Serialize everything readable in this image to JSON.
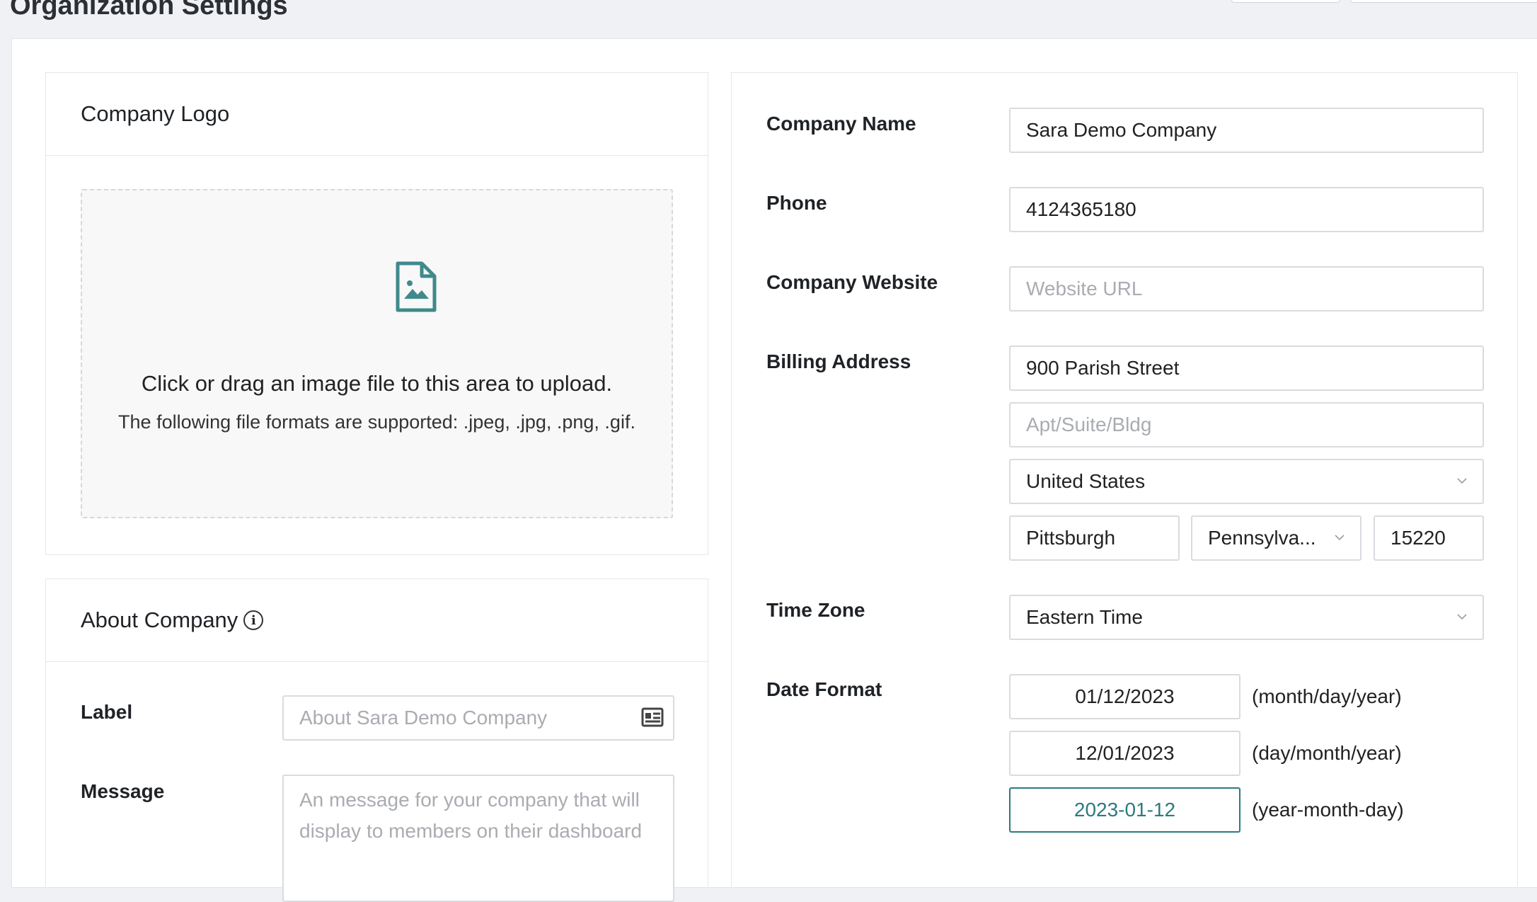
{
  "page": {
    "title": "Organization Settings"
  },
  "logo_card": {
    "title": "Company Logo",
    "drop_title": "Click or drag an image file to this area to upload.",
    "drop_subtitle": "The following file formats are supported: .jpeg, .jpg, .png, .gif.",
    "icon": "image-file-icon"
  },
  "about_card": {
    "title": "About Company",
    "label_field": {
      "label": "Label",
      "placeholder": "About Sara Demo Company",
      "icon": "id-card-icon"
    },
    "message_field": {
      "label": "Message",
      "placeholder": "An message for your company that will display to members on their dashboard"
    }
  },
  "company": {
    "name": {
      "label": "Company Name",
      "value": "Sara Demo Company"
    },
    "phone": {
      "label": "Phone",
      "value": "4124365180"
    },
    "website": {
      "label": "Company Website",
      "placeholder": "Website URL"
    },
    "billing": {
      "label": "Billing Address",
      "street": "900 Parish Street",
      "apt_placeholder": "Apt/Suite/Bldg",
      "country": "United States",
      "city": "Pittsburgh",
      "state": "Pennsylva...",
      "zip": "15220"
    },
    "timezone": {
      "label": "Time Zone",
      "value": "Eastern Time"
    },
    "date_format": {
      "label": "Date Format",
      "options": [
        {
          "example": "01/12/2023",
          "note": "(month/day/year)",
          "selected": false
        },
        {
          "example": "12/01/2023",
          "note": "(day/month/year)",
          "selected": false
        },
        {
          "example": "2023-01-12",
          "note": "(year-month-day)",
          "selected": true
        }
      ]
    }
  },
  "colors": {
    "accent": "#2b7b80",
    "border": "#d9dbdf",
    "placeholder": "#a9acb1"
  }
}
